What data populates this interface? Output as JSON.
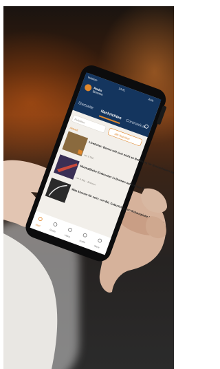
{
  "app": {
    "logo_line1": "Radio",
    "logo_line2": "Bremen"
  },
  "status": {
    "time": "13:41",
    "carrier": "Telekom",
    "battery": "41%"
  },
  "tabs": [
    "Startseite",
    "Nachrichten",
    "Coronavirus"
  ],
  "search": {
    "placeholder": "Rubriken"
  },
  "news_button": "alle Rubriken",
  "section_label": "Aktuell",
  "articles": [
    {
      "title": "Liveticker: Bonus will sich nicht an Befreiung für Bremerhaven Sparkassen beteiligen",
      "meta": "vor 2 Std."
    },
    {
      "title": "Mutmaßliche Einbrecher in Bremen auf frischer Tat ertappt",
      "meta": "vor 4 Std. · Bremen"
    },
    {
      "title": "Was können für sein: von Bü, Geburtstag von Schauspieler Bruno Ganz",
      "meta": ""
    }
  ],
  "bottom_nav": [
    "Start",
    "Radio",
    "Video",
    "Audio",
    "Mehr"
  ],
  "colors": {
    "header": "#14355e",
    "accent": "#e0872c",
    "screen_bg": "#f2efea"
  }
}
